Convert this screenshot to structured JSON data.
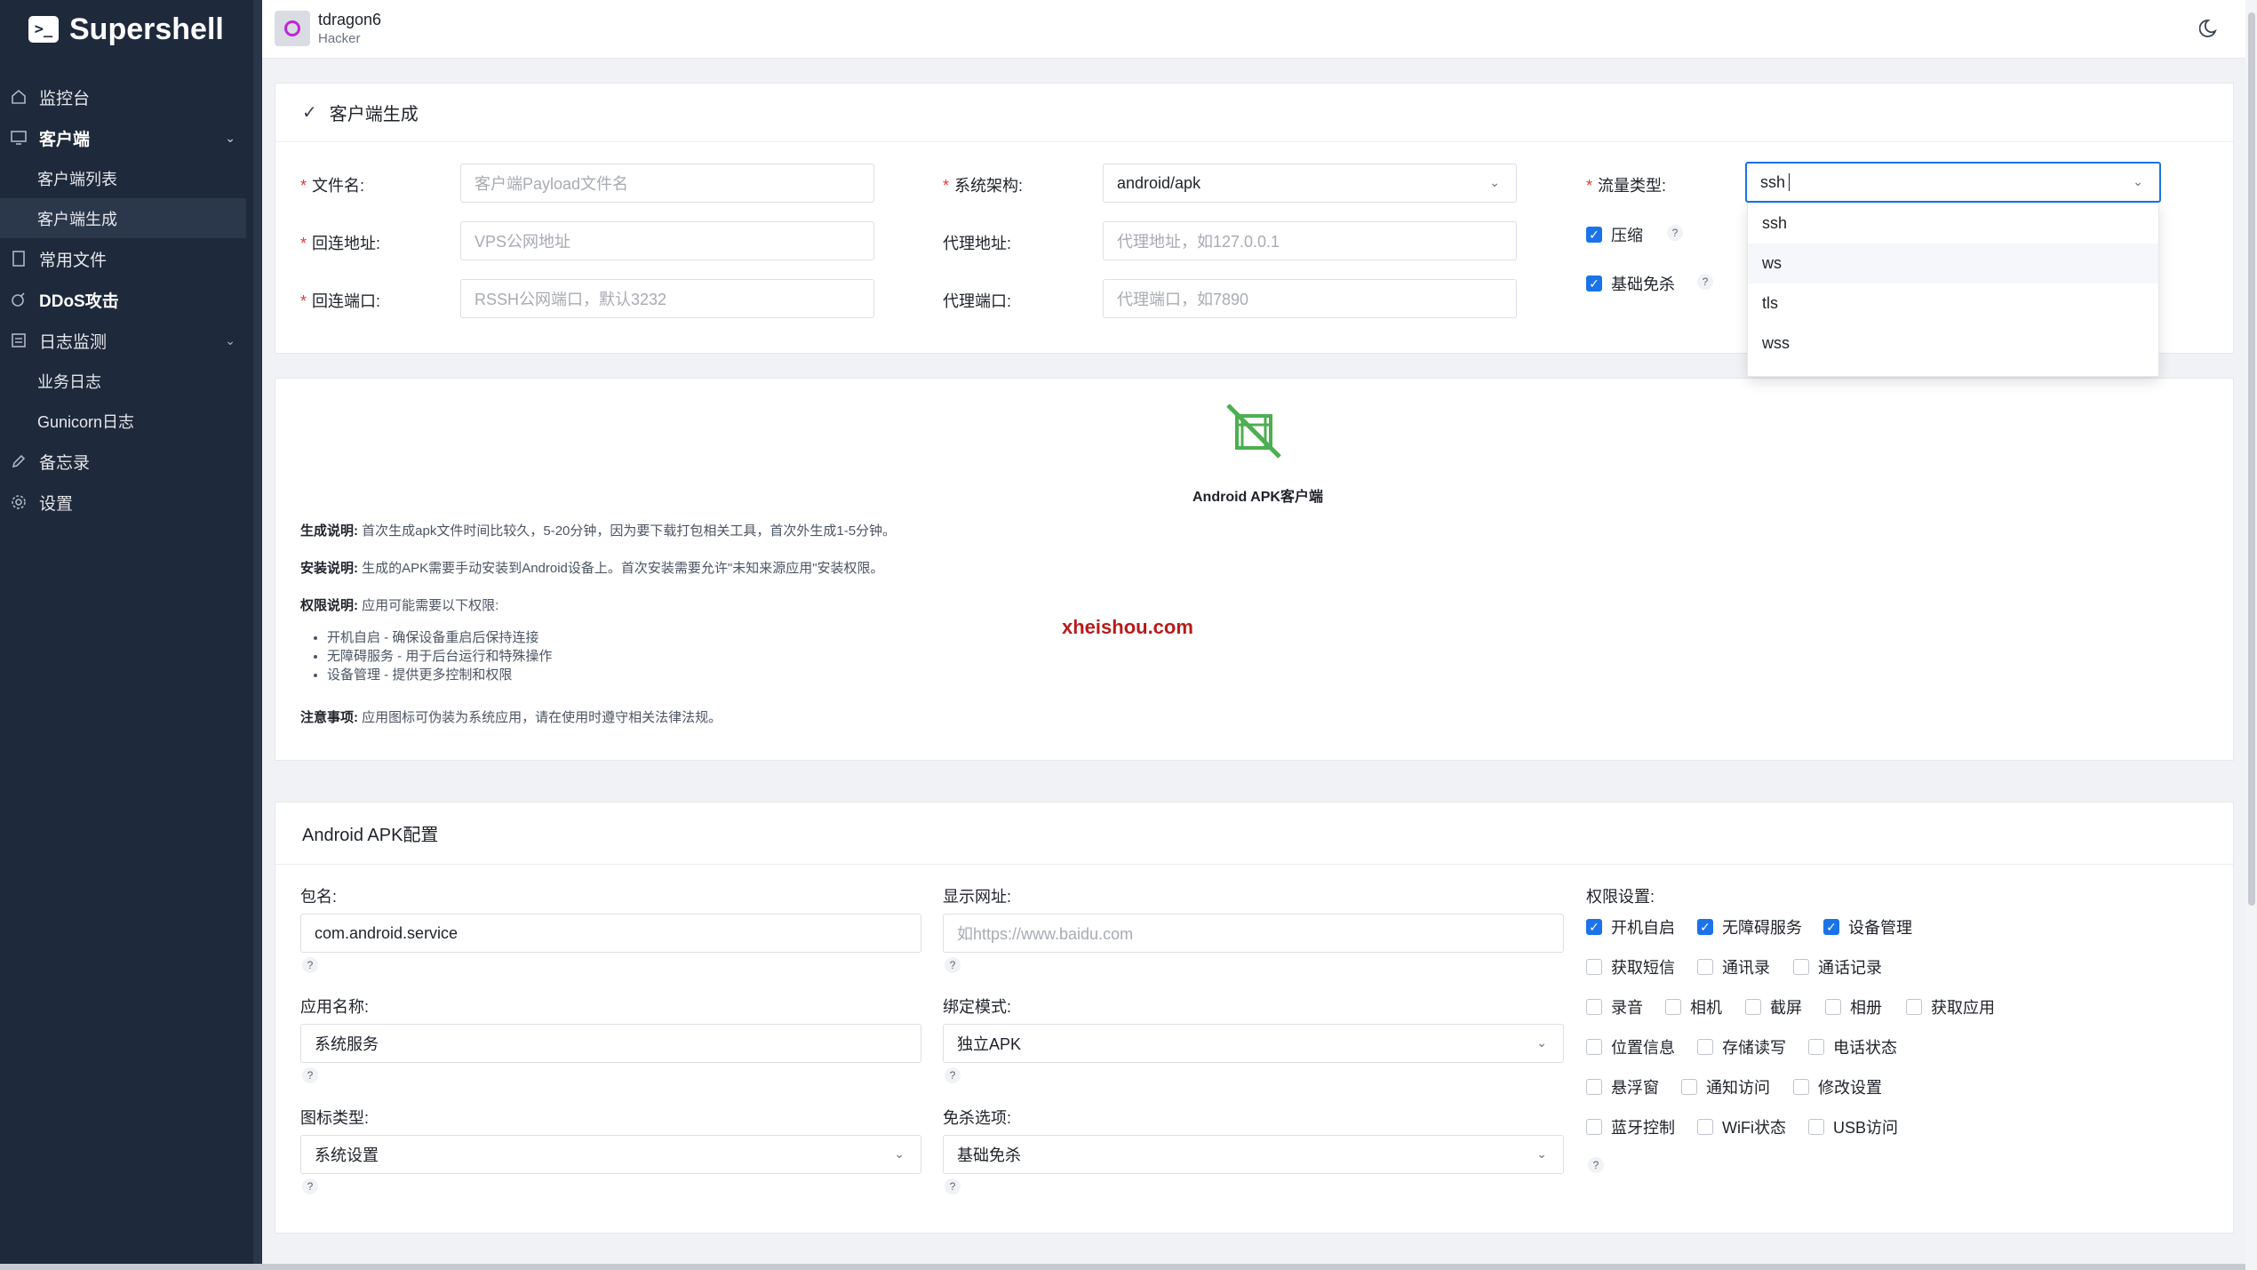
{
  "app": {
    "name": "Supershell",
    "logo_glyph": ">_"
  },
  "sidebar": {
    "items": [
      {
        "label": "监控台",
        "icon": "home-icon"
      },
      {
        "label": "客户端",
        "icon": "monitor-icon"
      },
      {
        "label": "常用文件",
        "icon": "file-icon"
      },
      {
        "label": "DDoS攻击",
        "icon": "bomb-icon"
      },
      {
        "label": "日志监测",
        "icon": "log-icon"
      },
      {
        "label": "备忘录",
        "icon": "pencil-icon"
      },
      {
        "label": "设置",
        "icon": "gear-icon"
      }
    ],
    "client_sub": [
      "客户端列表",
      "客户端生成"
    ],
    "log_sub": [
      "业务日志",
      "Gunicorn日志"
    ]
  },
  "user": {
    "name": "tdragon6",
    "role": "Hacker"
  },
  "gen": {
    "title": "客户端生成",
    "filename_label": "文件名:",
    "filename_placeholder": "客户端Payload文件名",
    "arch_label": "系统架构:",
    "arch_value": "android/apk",
    "traffic_label": "流量类型:",
    "traffic_value": "ssh",
    "callback_label": "回连地址:",
    "callback_placeholder": "VPS公网地址",
    "proxy_addr_label": "代理地址:",
    "proxy_addr_placeholder": "代理地址，如127.0.0.1",
    "compress_label": "压缩",
    "port_label": "回连端口:",
    "port_placeholder": "RSSH公网端口，默认3232",
    "proxy_port_label": "代理端口:",
    "proxy_port_placeholder": "代理端口，如7890",
    "basic_av_label": "基础免杀",
    "traffic_options": [
      "ssh",
      "ws",
      "tls",
      "wss"
    ],
    "help_glyph": "?"
  },
  "info": {
    "apk_title": "Android APK客户端",
    "gen_label": "生成说明:",
    "gen_text": "首次生成apk文件时间比较久，5-20分钟，因为要下载打包相关工具，首次外生成1-5分钟。",
    "install_label": "安装说明:",
    "install_text": "生成的APK需要手动安装到Android设备上。首次安装需要允许\"未知来源应用\"安装权限。",
    "perm_label": "权限说明:",
    "perm_text": "应用可能需要以下权限:",
    "perm_list": [
      "开机自启 - 确保设备重启后保持连接",
      "无障碍服务 - 用于后台运行和特殊操作",
      "设备管理 - 提供更多控制和权限"
    ],
    "notice_label": "注意事项:",
    "notice_text": "应用图标可伪装为系统应用，请在使用时遵守相关法律法规。",
    "watermark": "xheishou.com"
  },
  "apk": {
    "title": "Android APK配置",
    "package_label": "包名:",
    "package_value": "com.android.service",
    "display_url_label": "显示网址:",
    "display_url_placeholder": "如https://www.baidu.com",
    "app_name_label": "应用名称:",
    "app_name_value": "系统服务",
    "bind_mode_label": "绑定模式:",
    "bind_mode_value": "独立APK",
    "icon_type_label": "图标类型:",
    "icon_type_value": "系统设置",
    "av_option_label": "免杀选项:",
    "av_option_value": "基础免杀",
    "perm_settings_label": "权限设置:",
    "perms": [
      [
        "开机自启",
        "无障碍服务",
        "设备管理"
      ],
      [
        "获取短信",
        "通讯录",
        "通话记录"
      ],
      [
        "录音",
        "相机",
        "截屏",
        "相册",
        "获取应用"
      ],
      [
        "位置信息",
        "存储读写",
        "电话状态"
      ],
      [
        "悬浮窗",
        "通知访问",
        "修改设置"
      ],
      [
        "蓝牙控制",
        "WiFi状态",
        "USB访问"
      ]
    ]
  },
  "colors": {
    "sidebar_bg": "#1e293b",
    "accent": "#1a73e8",
    "required": "#e53935",
    "android_icon": "#4caf50"
  }
}
